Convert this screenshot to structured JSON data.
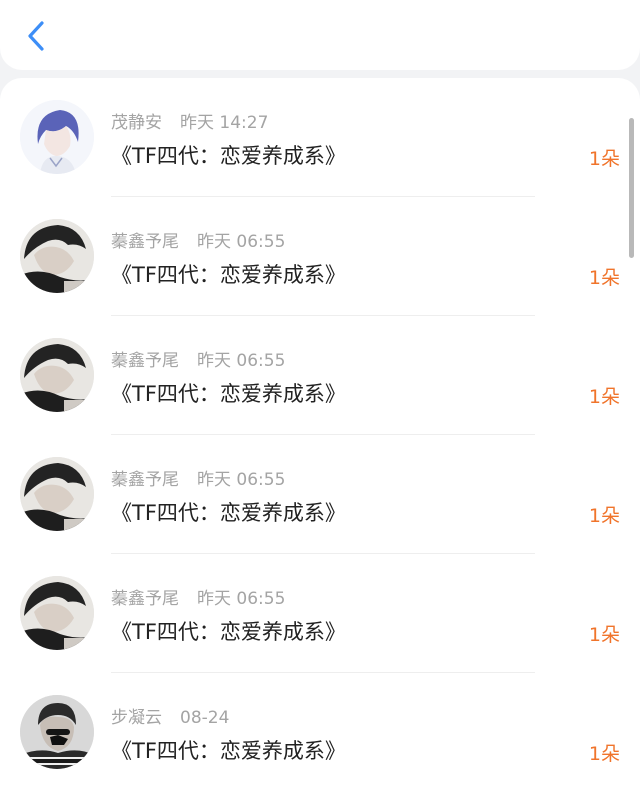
{
  "header": {
    "back_icon": "chevron-left-icon"
  },
  "colors": {
    "accent": "#f0742b",
    "back": "#3d8ef7",
    "meta": "#a4a4a4",
    "title": "#222222"
  },
  "items": [
    {
      "name": "茂静安",
      "time": "昨天 14:27",
      "title": "《TF四代：恋爱养成系》",
      "gift": "1朵",
      "avatar": "anime-avatar"
    },
    {
      "name": "蓁鑫予尾",
      "time": "昨天 06:55",
      "title": "《TF四代：恋爱养成系》",
      "gift": "1朵",
      "avatar": "photo-avatar"
    },
    {
      "name": "蓁鑫予尾",
      "time": "昨天 06:55",
      "title": "《TF四代：恋爱养成系》",
      "gift": "1朵",
      "avatar": "photo-avatar"
    },
    {
      "name": "蓁鑫予尾",
      "time": "昨天 06:55",
      "title": "《TF四代：恋爱养成系》",
      "gift": "1朵",
      "avatar": "photo-avatar"
    },
    {
      "name": "蓁鑫予尾",
      "time": "昨天 06:55",
      "title": "《TF四代：恋爱养成系》",
      "gift": "1朵",
      "avatar": "photo-avatar"
    },
    {
      "name": "步凝云",
      "time": "08-24",
      "title": "《TF四代：恋爱养成系》",
      "gift": "1朵",
      "avatar": "photo-avatar-2"
    }
  ]
}
